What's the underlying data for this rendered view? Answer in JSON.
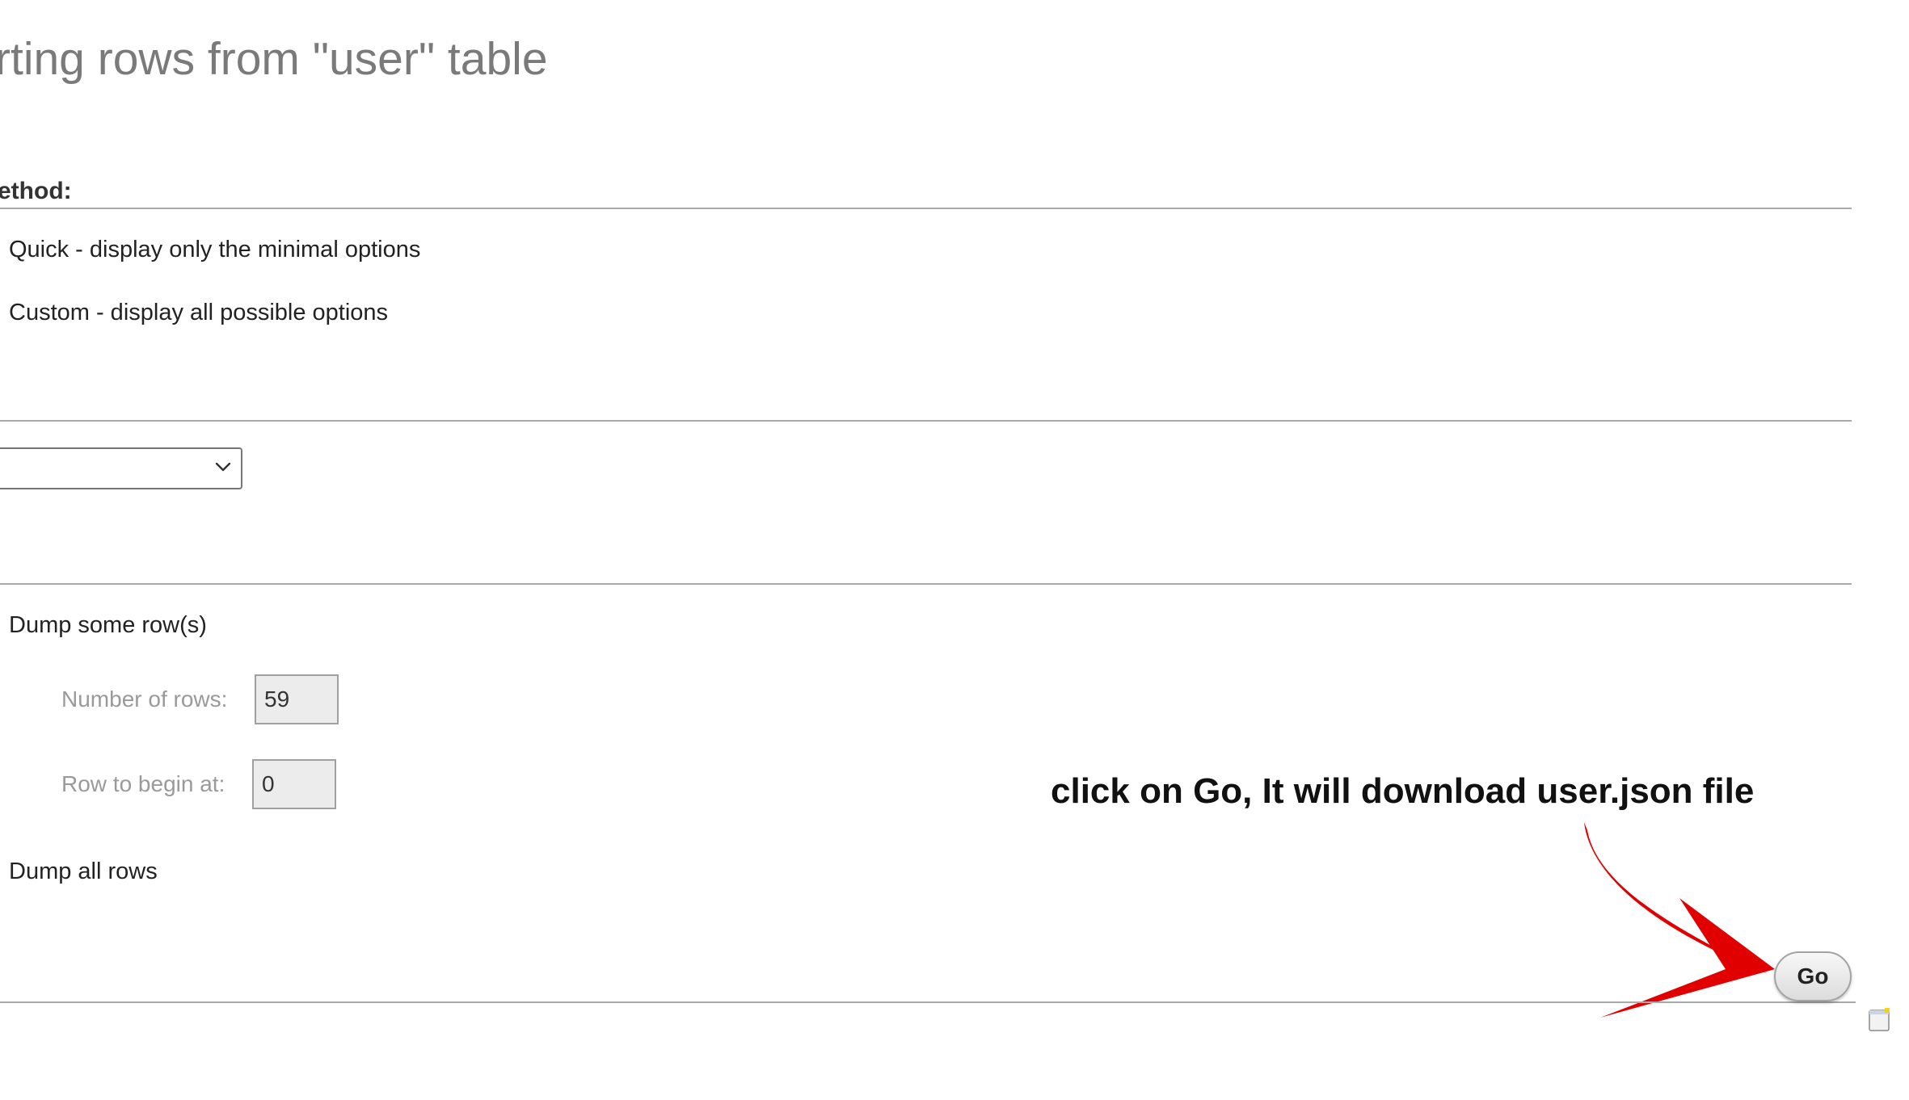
{
  "page": {
    "title": "rting rows from \"user\" table"
  },
  "export_method": {
    "legend": "ethod:",
    "options": [
      {
        "label": "Quick - display only the minimal options"
      },
      {
        "label": "Custom - display all possible options"
      }
    ]
  },
  "format": {
    "selected": ""
  },
  "rows": {
    "options": [
      {
        "label": "Dump some row(s)"
      },
      {
        "label": "Dump all rows"
      }
    ],
    "number_of_rows_label": "Number of rows:",
    "number_of_rows_value": "59",
    "row_to_begin_label": "Row to begin at:",
    "row_to_begin_value": "0"
  },
  "annotation": {
    "text": "click on Go, It will download user.json file",
    "arrow_color": "#e10000",
    "arrow_icon": "red-curved-arrow-icon"
  },
  "actions": {
    "go_label": "Go"
  },
  "icons": {
    "corner": "window-icon"
  }
}
